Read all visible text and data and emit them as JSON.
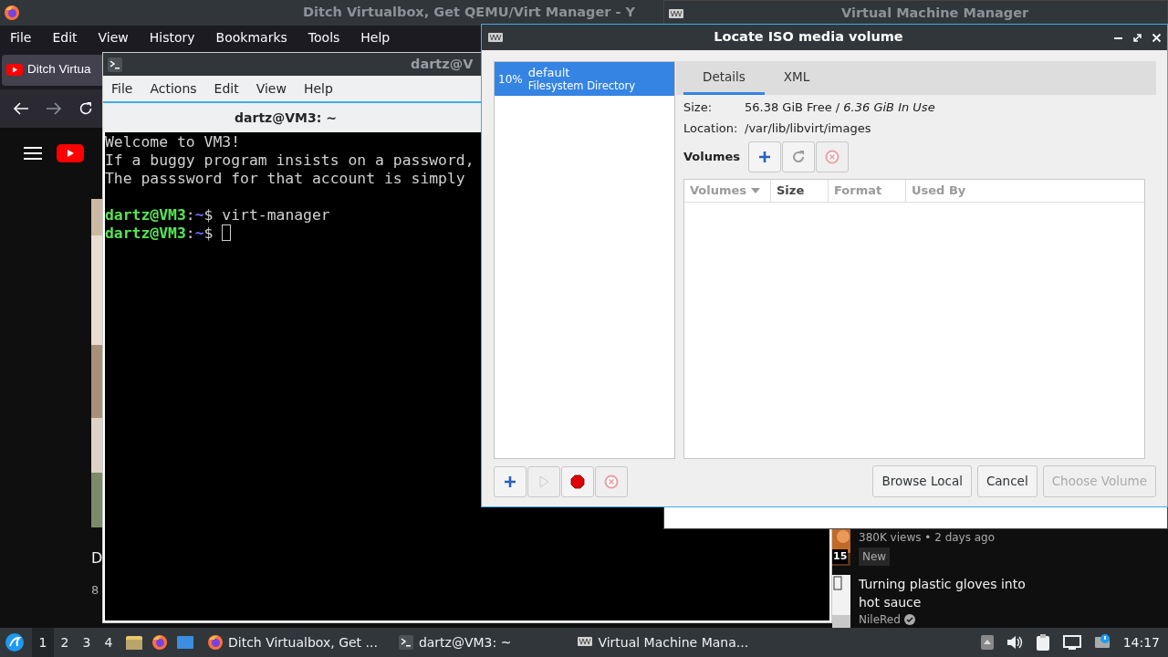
{
  "browser": {
    "title": "Ditch Virtualbox, Get QEMU/Virt Manager - Y",
    "menu": [
      "File",
      "Edit",
      "View",
      "History",
      "Bookmarks",
      "Tools",
      "Help"
    ],
    "tab": {
      "label": "Ditch Virtua"
    },
    "left_fragments": [
      "D",
      "8"
    ],
    "videos": [
      {
        "duration": "15",
        "meta": "380K views • 2 days ago",
        "badge": "New"
      },
      {
        "title": "Turning plastic gloves into hot sauce",
        "channel": "NileRed"
      }
    ]
  },
  "vmm_window": {
    "title": "Virtual Machine Manager"
  },
  "terminal": {
    "title": "dartz@V",
    "menu": [
      "File",
      "Actions",
      "Edit",
      "View",
      "Help"
    ],
    "tab": "dartz@VM3: ~",
    "lines": [
      {
        "kind": "text",
        "text": "Welcome to VM3!"
      },
      {
        "kind": "text",
        "text": "If a buggy program insists on a password,"
      },
      {
        "kind": "text",
        "text": "The passsword for that account is simply"
      },
      {
        "kind": "blank"
      },
      {
        "kind": "prompt",
        "user": "dartz@VM3",
        "sep": ":",
        "path": "~",
        "sigil": "$",
        "command": "virt-manager"
      },
      {
        "kind": "prompt",
        "user": "dartz@VM3",
        "sep": ":",
        "path": "~",
        "sigil": "$",
        "cursor": true
      }
    ]
  },
  "dialog": {
    "title": "Locate ISO media volume",
    "pools": [
      {
        "usage": "10%",
        "name": "default",
        "type": "Filesystem Directory",
        "selected": true
      }
    ],
    "tabs": [
      {
        "label": "Details",
        "selected": true
      },
      {
        "label": "XML",
        "selected": false
      }
    ],
    "size_label": "Size:",
    "size_value": "56.38 GiB Free / *6.36 GiB In Use*",
    "location_label": "Location:",
    "location": "/var/lib/libvirt/images",
    "volumes_label": "Volumes",
    "volume_tools": [
      {
        "kind": "add",
        "disabled": false
      },
      {
        "kind": "refresh",
        "disabled": false
      },
      {
        "kind": "delete",
        "disabled": true
      }
    ],
    "columns": [
      {
        "label": "Volumes",
        "sorted": true,
        "active": false
      },
      {
        "label": "Size",
        "sorted": false,
        "active": true
      },
      {
        "label": "Format",
        "sorted": false,
        "active": false
      },
      {
        "label": "Used By",
        "sorted": false,
        "active": false
      }
    ],
    "pool_tools": [
      {
        "kind": "add",
        "disabled": false
      },
      {
        "kind": "start",
        "disabled": true
      },
      {
        "kind": "stop",
        "disabled": false
      },
      {
        "kind": "delete",
        "disabled": true
      }
    ],
    "buttons": [
      {
        "label": "Browse Local",
        "disabled": false
      },
      {
        "label": "Cancel",
        "disabled": false
      },
      {
        "label": "Choose Volume",
        "disabled": true
      }
    ]
  },
  "taskbar": {
    "desktops": [
      {
        "label": "1",
        "selected": true
      },
      {
        "label": "2",
        "selected": false
      },
      {
        "label": "3",
        "selected": false
      },
      {
        "label": "4",
        "selected": false
      }
    ],
    "tasks": [
      {
        "kind": "browser",
        "label": "Ditch Virtualbox, Get ..."
      },
      {
        "kind": "terminal",
        "label": "dartz@VM3: ~"
      },
      {
        "kind": "vmm",
        "label": "Virtual Machine Mana..."
      }
    ],
    "clock": "14:17"
  }
}
